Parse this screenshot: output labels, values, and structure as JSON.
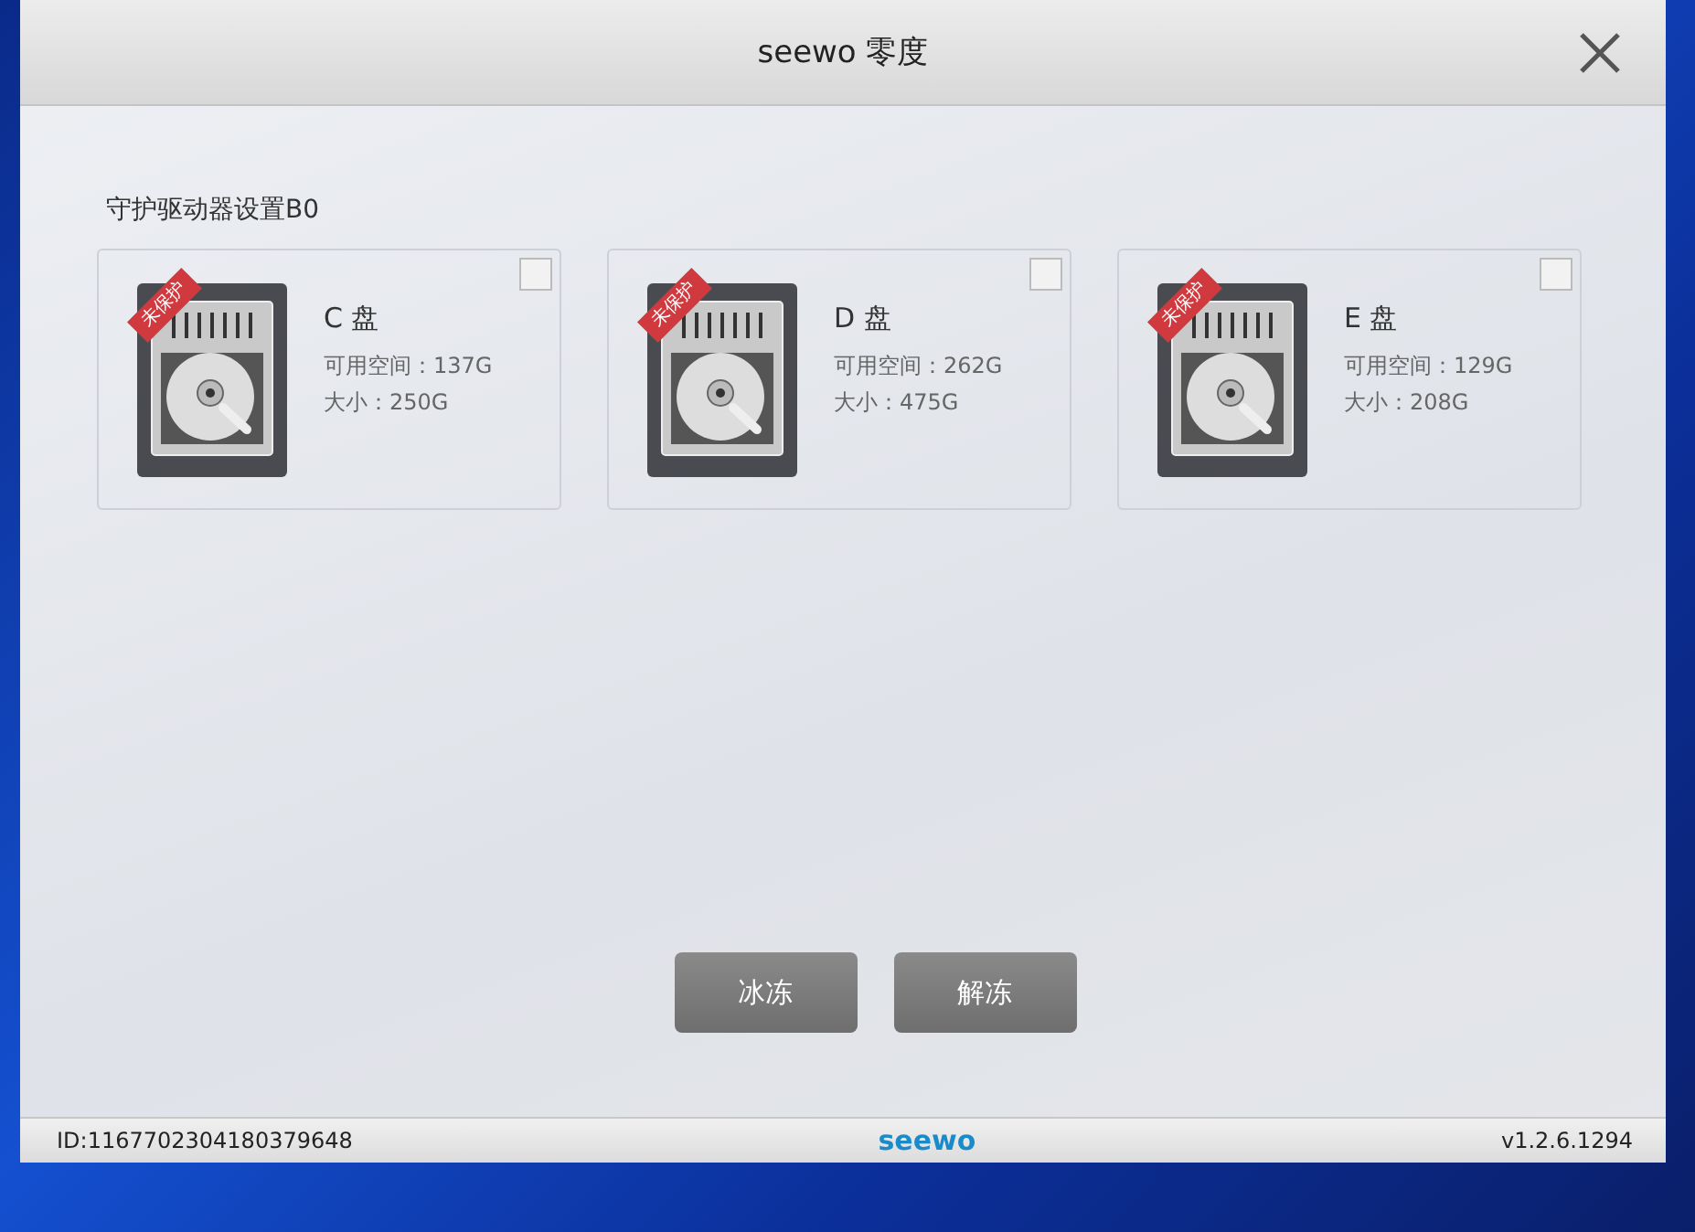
{
  "window": {
    "title": "seewo 零度"
  },
  "section_title": "守护驱动器设置B0",
  "drives": [
    {
      "name": "C 盘",
      "free": "可用空间：137G",
      "size": "大小：250G",
      "badge": "未保护",
      "checked": false
    },
    {
      "name": "D 盘",
      "free": "可用空间：262G",
      "size": "大小：475G",
      "badge": "未保护",
      "checked": false
    },
    {
      "name": "E 盘",
      "free": "可用空间：129G",
      "size": "大小：208G",
      "badge": "未保护",
      "checked": false
    }
  ],
  "buttons": [
    "冰冻",
    "解冻"
  ],
  "status_bar": {
    "id": "ID:1167702304180379648",
    "logo": "seewo",
    "version": "v1.2.6.1294"
  }
}
